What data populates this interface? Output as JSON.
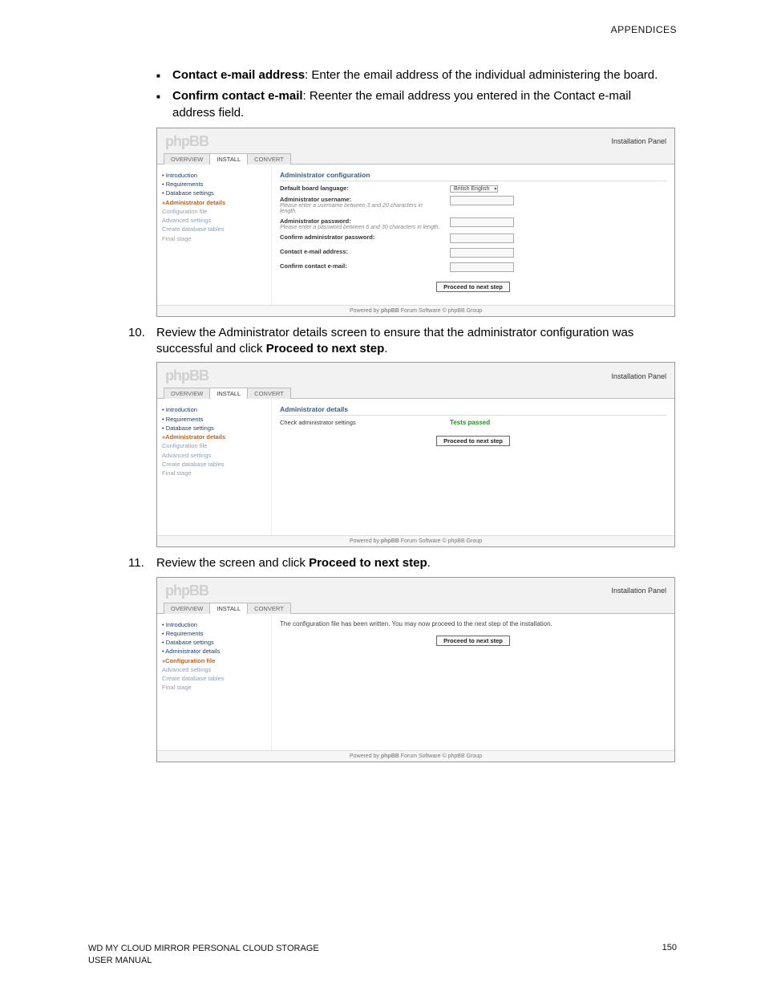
{
  "header_right": "APPENDICES",
  "bullets": [
    {
      "label": "Contact e-mail address",
      "text": ": Enter the email address of the individual administering the board."
    },
    {
      "label": "Confirm contact e-mail",
      "text": ": Reenter the email address you entered in the Contact e-mail address field."
    }
  ],
  "steps": {
    "s10_num": "10.",
    "s10_text_a": "Review the Administrator details screen to ensure that the administrator configuration was successful and click ",
    "s10_text_b": "Proceed to next step",
    "s10_text_c": ".",
    "s11_num": "11.",
    "s11_text_a": "Review the screen and click ",
    "s11_text_b": "Proceed to next step",
    "s11_text_c": "."
  },
  "common": {
    "logo": "phpBB",
    "panel_title": "Installation Panel",
    "tabs": {
      "overview": "OVERVIEW",
      "install": "INSTALL",
      "convert": "CONVERT"
    },
    "nav": {
      "intro": "Introduction",
      "req": "Requirements",
      "db": "Database settings",
      "admin": "Administrator details",
      "conf": "Configuration file",
      "adv": "Advanced settings",
      "cdb": "Create database tables",
      "final": "Final stage"
    },
    "proceed": "Proceed to next step",
    "footer_a": "Powered by ",
    "footer_b": "phpBB",
    "footer_c": " Forum Software © phpBB Group"
  },
  "panel1": {
    "section": "Administrator configuration",
    "rows": {
      "lang_label": "Default board language:",
      "lang_value": "British English",
      "user_label": "Administrator username:",
      "user_hint": "Please enter a username between 3 and 20 characters in length.",
      "pass_label": "Administrator password:",
      "pass_hint": "Please enter a password between 6 and 30 characters in length.",
      "cpass_label": "Confirm administrator password:",
      "email_label": "Contact e-mail address:",
      "cemail_label": "Confirm contact e-mail:"
    }
  },
  "panel2": {
    "section": "Administrator details",
    "check_label": "Check administrator settings",
    "tests_passed": "Tests passed"
  },
  "panel3": {
    "message": "The configuration file has been written. You may now proceed to the next step of the installation."
  },
  "footer": {
    "left1": "WD MY CLOUD MIRROR PERSONAL CLOUD STORAGE",
    "left2": "USER MANUAL",
    "page": "150"
  }
}
